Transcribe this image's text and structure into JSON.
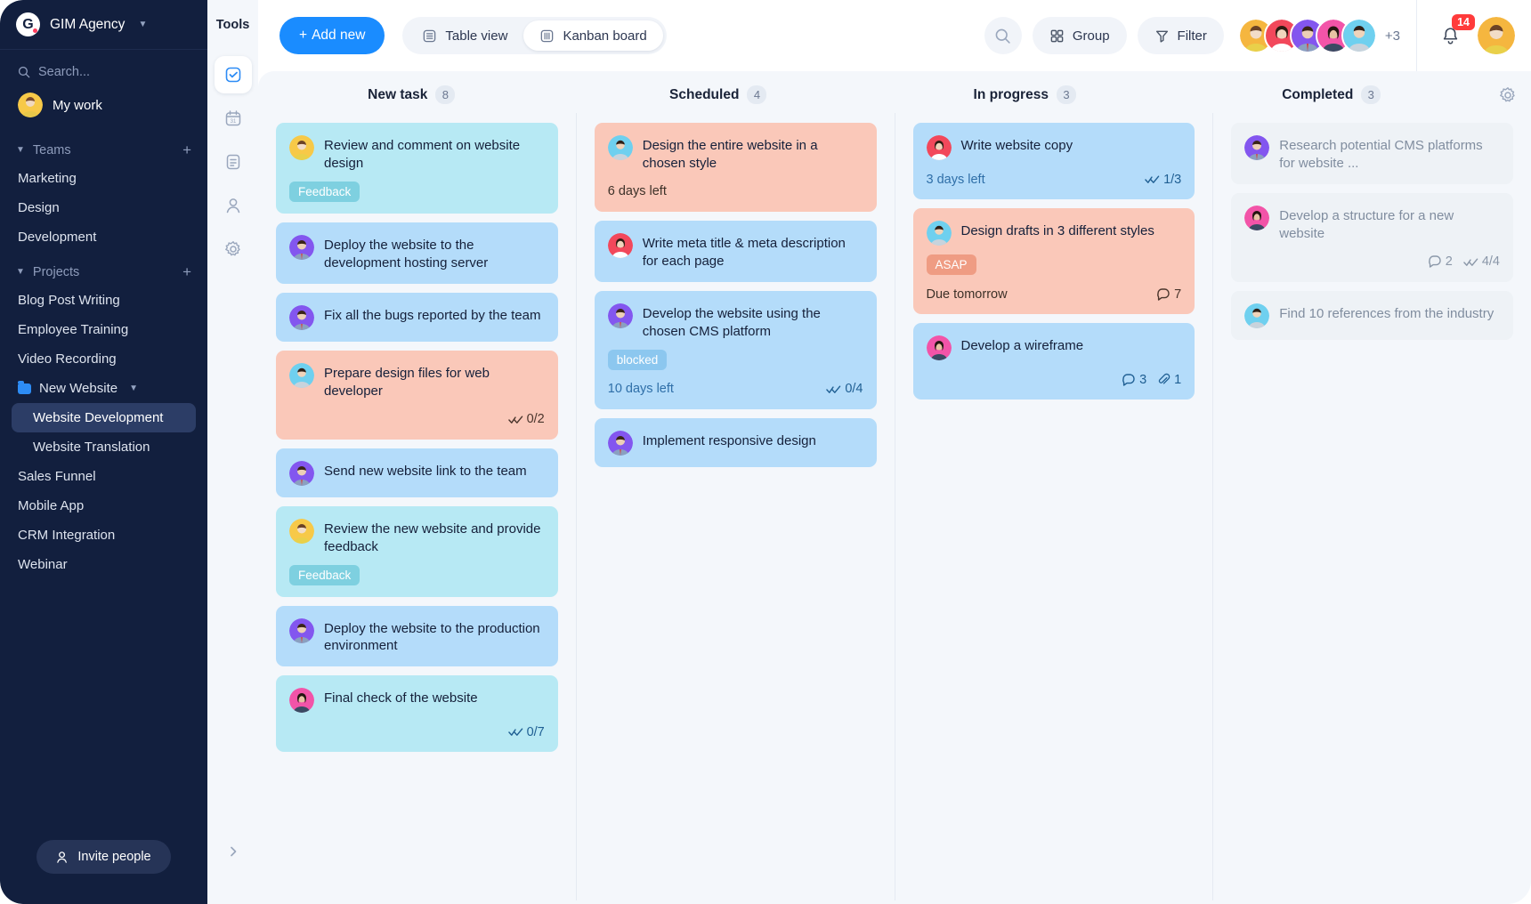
{
  "sidebar": {
    "brand": {
      "logo_letter": "G",
      "name": "GIM Agency",
      "caret_icon": "chevron-down-icon"
    },
    "search": {
      "placeholder": "Search...",
      "icon": "search-icon"
    },
    "my_work": {
      "label": "My work"
    },
    "teams": {
      "title": "Teams",
      "add_icon": "plus-icon",
      "items": [
        {
          "label": "Marketing"
        },
        {
          "label": "Design"
        },
        {
          "label": "Development"
        }
      ]
    },
    "projects": {
      "title": "Projects",
      "add_icon": "plus-icon",
      "items": [
        {
          "label": "Blog Post Writing",
          "type": "item"
        },
        {
          "label": "Employee Training",
          "type": "item"
        },
        {
          "label": "Video Recording",
          "type": "item"
        },
        {
          "label": "New Website",
          "type": "folder"
        },
        {
          "label": "Website Development",
          "type": "sub",
          "active": true
        },
        {
          "label": "Website Translation",
          "type": "sub",
          "active": false
        },
        {
          "label": "Sales Funnel",
          "type": "item"
        },
        {
          "label": "Mobile App",
          "type": "item"
        },
        {
          "label": "CRM Integration",
          "type": "item"
        },
        {
          "label": "Webinar",
          "type": "item"
        }
      ]
    },
    "invite": {
      "label": "Invite people",
      "icon": "person-add-icon"
    }
  },
  "rail": {
    "title": "Tools",
    "items": [
      {
        "icon": "tasks-check-icon",
        "active": true
      },
      {
        "icon": "calendar-icon",
        "active": false
      },
      {
        "icon": "notes-icon",
        "active": false
      },
      {
        "icon": "contacts-person-icon",
        "active": false
      },
      {
        "icon": "gear-icon",
        "active": false
      }
    ],
    "collapse_icon": "chevron-right-icon"
  },
  "topbar": {
    "add_new": {
      "label": "Add new",
      "icon": "plus-icon"
    },
    "views": [
      {
        "label": "Table view",
        "icon": "table-icon",
        "active": false
      },
      {
        "label": "Kanban board",
        "icon": "kanban-icon",
        "active": true
      }
    ],
    "search_icon": "search-icon",
    "group": {
      "label": "Group",
      "icon": "grid-icon"
    },
    "filter": {
      "label": "Filter",
      "icon": "funnel-icon"
    },
    "members_overflow": "+3",
    "notifications": {
      "count": "14",
      "icon": "bell-icon"
    }
  },
  "board": {
    "settings_icon": "gear-icon",
    "columns": [
      {
        "title": "New task",
        "count": "8",
        "cards": [
          {
            "title": "Review and comment on website design",
            "color": "cyan",
            "avatar": "woman-yellow",
            "tag": {
              "label": "Feedback",
              "style": "feedback"
            }
          },
          {
            "title": "Deploy the website to the development hosting server",
            "color": "blue",
            "avatar": "man-purple"
          },
          {
            "title": "Fix all the bugs reported by the team",
            "color": "blue",
            "avatar": "man-purple"
          },
          {
            "title": "Prepare design files for web developer",
            "color": "peach",
            "avatar": "man-lightblue",
            "checklist": "0/2"
          },
          {
            "title": "Send new website link to the team",
            "color": "blue",
            "avatar": "man-purple"
          },
          {
            "title": "Review the new website and provide feedback",
            "color": "cyan",
            "avatar": "woman-yellow",
            "tag": {
              "label": "Feedback",
              "style": "feedback"
            }
          },
          {
            "title": "Deploy the website to the production environment",
            "color": "blue",
            "avatar": "man-purple"
          },
          {
            "title": "Final check of the website",
            "color": "cyan",
            "avatar": "woman-pink",
            "checklist": "0/7"
          }
        ]
      },
      {
        "title": "Scheduled",
        "count": "4",
        "cards": [
          {
            "title": "Design the entire website in a chosen style",
            "color": "peach",
            "avatar": "man-lightblue",
            "due": "6 days left",
            "due_style": "dark"
          },
          {
            "title": "Write meta title & meta description for each page",
            "color": "blue",
            "avatar": "woman-red"
          },
          {
            "title": "Develop the website using the chosen CMS platform",
            "color": "blue",
            "avatar": "man-purple",
            "tag": {
              "label": "blocked",
              "style": "blocked"
            },
            "due": "10 days left",
            "due_style": "blue",
            "checklist": "0/4"
          },
          {
            "title": "Implement responsive design",
            "color": "blue",
            "avatar": "man-purple"
          }
        ]
      },
      {
        "title": "In progress",
        "count": "3",
        "cards": [
          {
            "title": "Write website copy",
            "color": "blue",
            "avatar": "woman-red",
            "due": "3 days left",
            "due_style": "blue",
            "checklist": "1/3"
          },
          {
            "title": "Design drafts in 3 different styles",
            "color": "peach",
            "avatar": "man-lightblue",
            "tag": {
              "label": "ASAP",
              "style": "asap"
            },
            "due": "Due tomorrow",
            "due_style": "dark",
            "comments": "7"
          },
          {
            "title": "Develop a wireframe",
            "color": "blue",
            "avatar": "woman-pink",
            "comments": "3",
            "attachments": "1"
          }
        ]
      },
      {
        "title": "Completed",
        "count": "3",
        "cards": [
          {
            "title": "Research potential CMS platforms for website ...",
            "color": "grey",
            "avatar": "man-purple"
          },
          {
            "title": "Develop a structure for a new website",
            "color": "grey",
            "avatar": "woman-pink",
            "comments": "2",
            "checklist": "4/4"
          },
          {
            "title": "Find 10 references from the industry",
            "color": "grey",
            "avatar": "man-lightblue"
          }
        ]
      }
    ]
  },
  "colors": {
    "accent": "#1a8cff",
    "sidebar_bg": "#121f3e",
    "board_bg": "#f4f7fb",
    "card_blue": "#b4dcfa",
    "card_cyan": "#b7e9f4",
    "card_peach": "#fac8b9",
    "card_grey": "#eef2f6",
    "badge_red": "#ff3b3b"
  }
}
